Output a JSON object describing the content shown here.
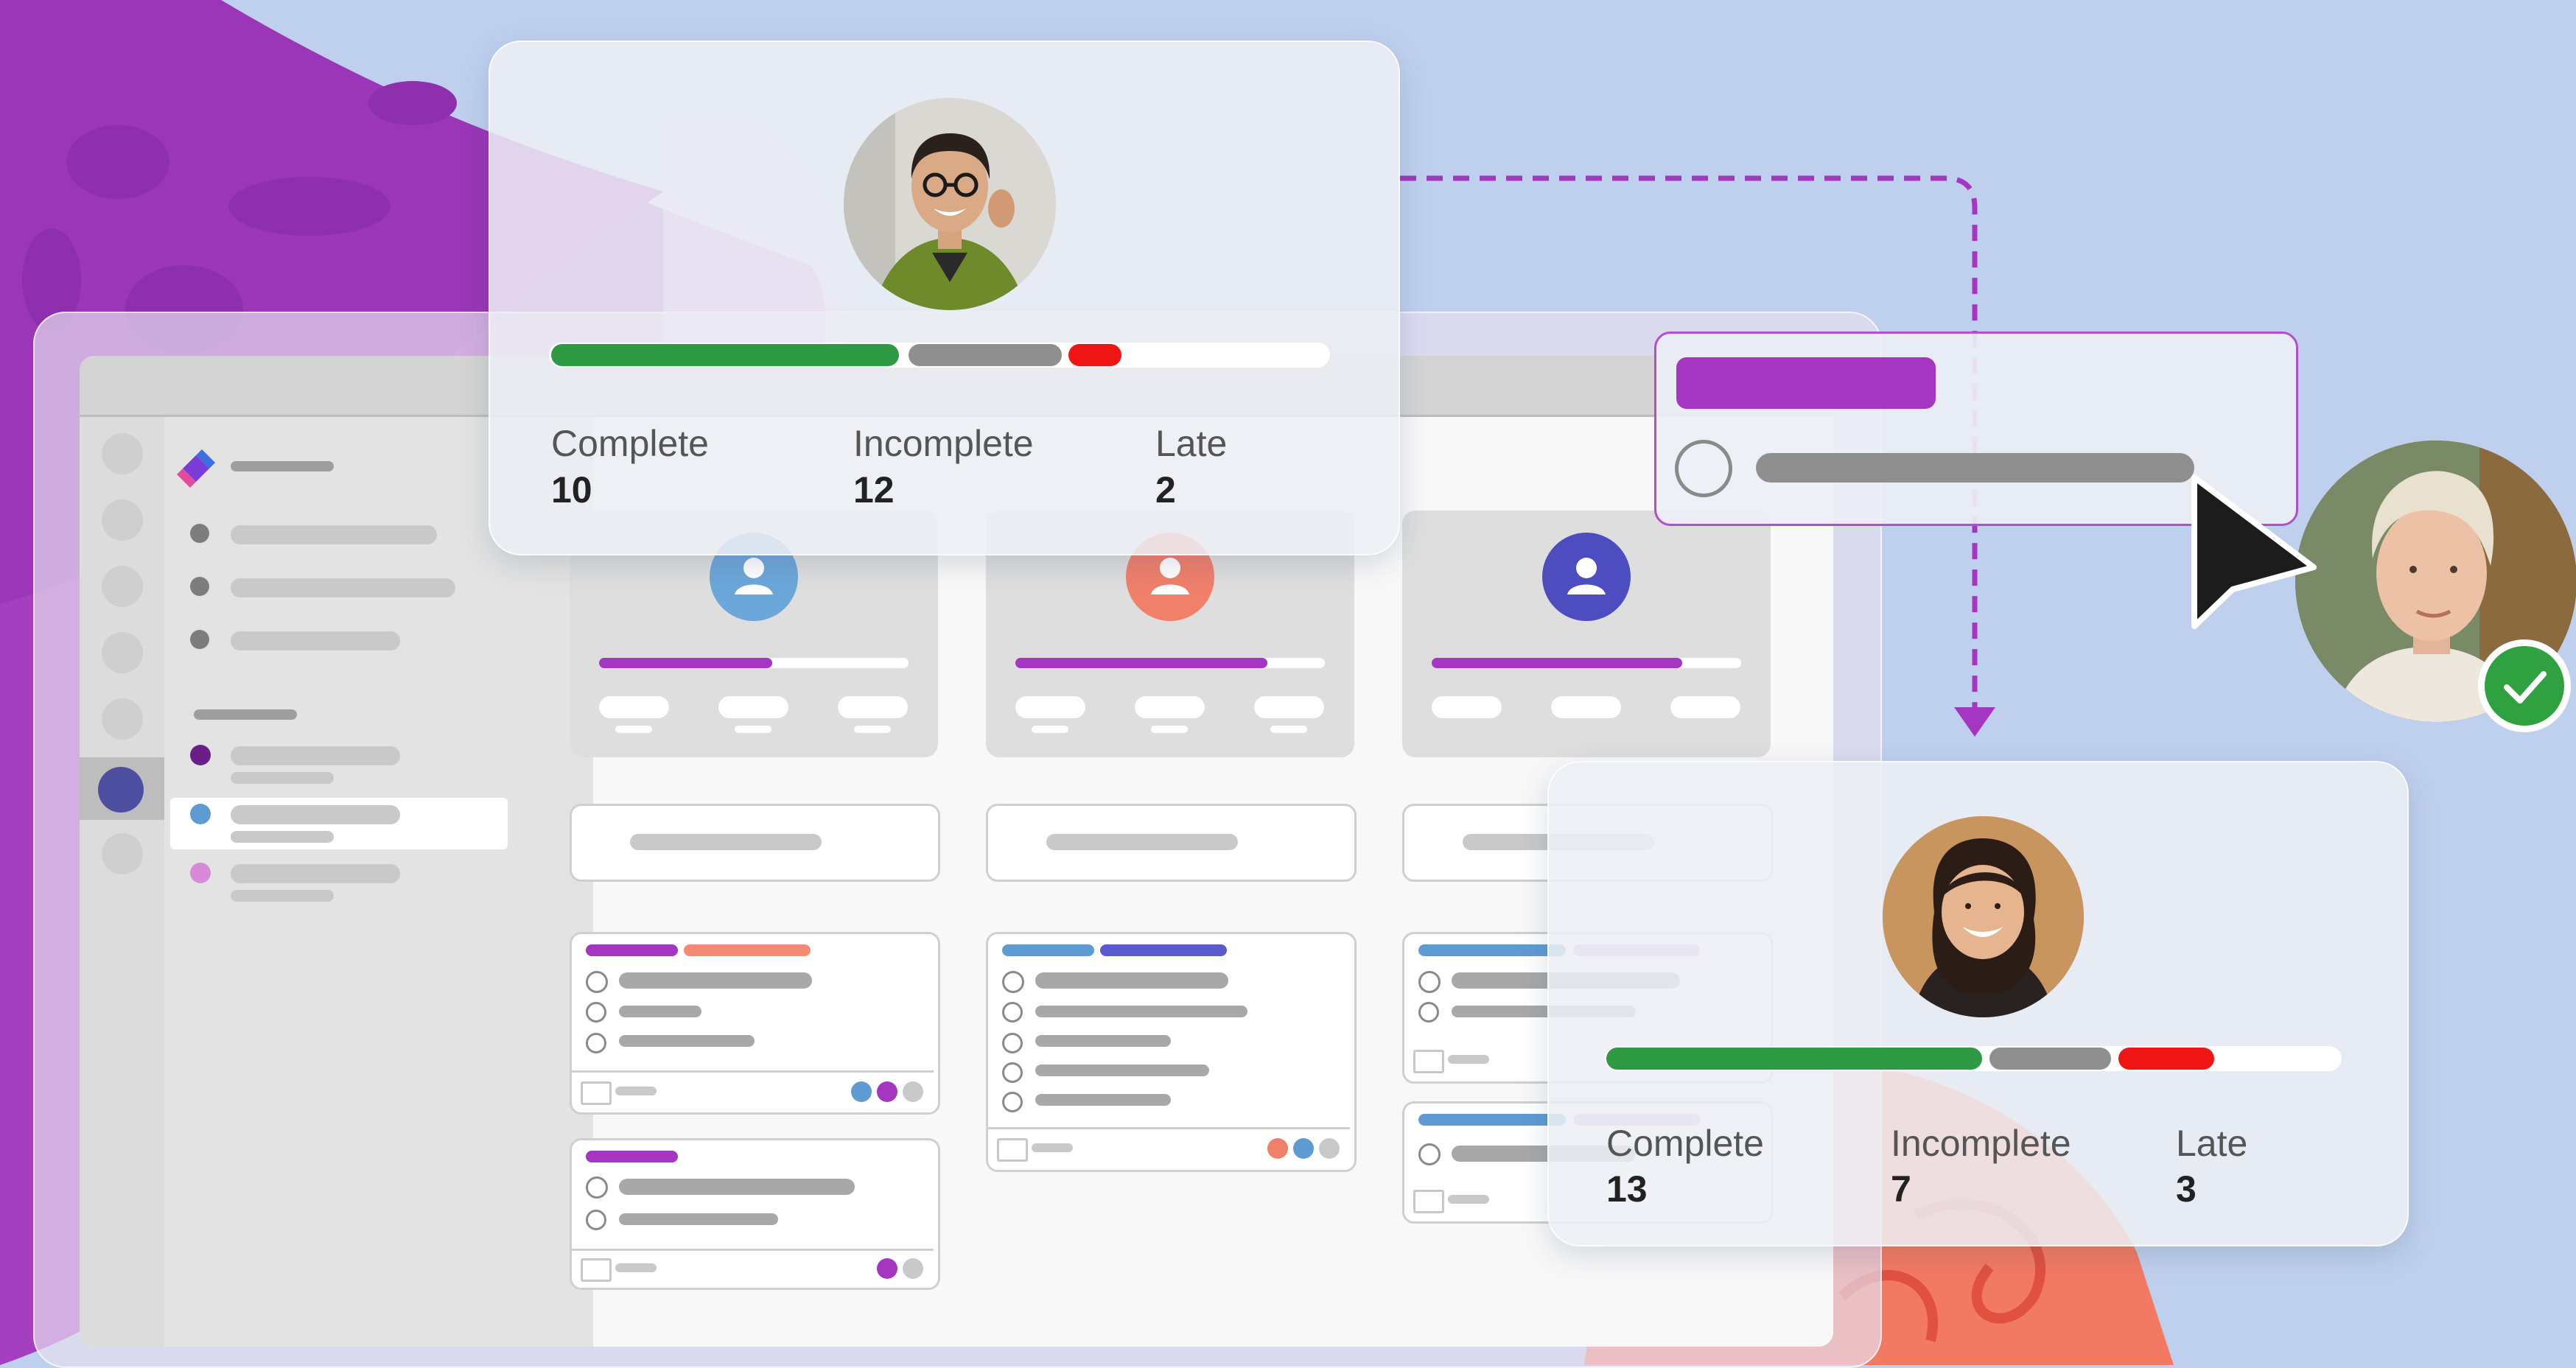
{
  "colors": {
    "background": "#bfd0ee",
    "purple_accent": "#a436c2",
    "complete": "#2f9a44",
    "incomplete": "#8f8f8f",
    "late": "#f01515",
    "check_badge": "#2fa141"
  },
  "top_card": {
    "progress": {
      "complete": 10,
      "incomplete": 12,
      "late": 2
    },
    "stats": [
      {
        "label": "Complete",
        "value": "10"
      },
      {
        "label": "Incomplete",
        "value": "12"
      },
      {
        "label": "Late",
        "value": "2"
      }
    ]
  },
  "bottom_card": {
    "progress": {
      "complete": 13,
      "incomplete": 7,
      "late": 3
    },
    "stats": [
      {
        "label": "Complete",
        "value": "13"
      },
      {
        "label": "Incomplete",
        "value": "7"
      },
      {
        "label": "Late",
        "value": "3"
      }
    ]
  },
  "icons": {
    "app_logo": "planner-logo-icon",
    "cursor": "mouse-pointer-icon",
    "check": "checkmark-icon"
  }
}
